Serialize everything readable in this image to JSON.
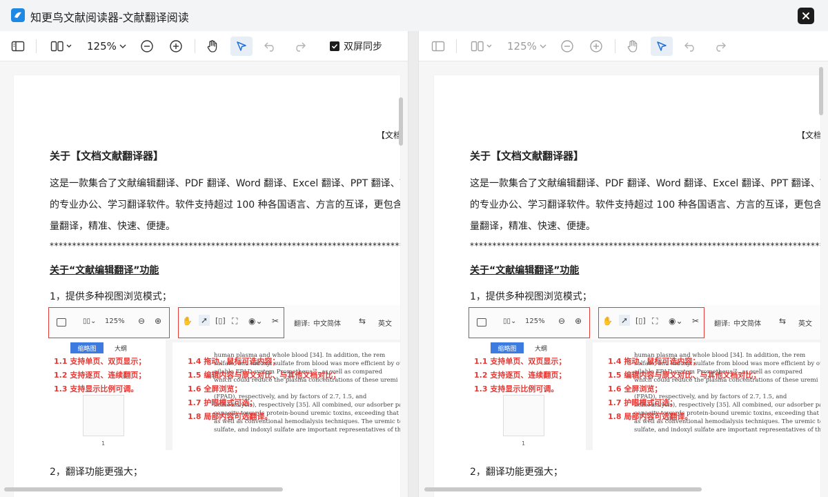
{
  "window": {
    "title": "知更鸟文献阅读器-文献翻译阅读"
  },
  "toolbar": {
    "zoom": "125%",
    "sync_label": "双屏同步",
    "sync_checked": true
  },
  "document": {
    "header_tag": "【文档",
    "title": "关于【文档文献翻译器】",
    "paragraph_lines": [
      "这是一款集合了文献编辑翻译、PDF 翻译、Word 翻译、Excel 翻译、PPT 翻译、TXT 翻",
      "的专业办公、学习翻译软件。软件支持超过 100 种各国语言、方言的互译，更包含了文",
      "量翻译，精准、快速、便捷。"
    ],
    "separator": "**********************************************************************************************************************",
    "section_title": "关于“文献编辑翻译”功能",
    "item1": "1，提供多种视图浏览模式；",
    "item2": "2，翻译功能更强大；",
    "illustration": {
      "zoom": "125%",
      "translate_label": "翻译:",
      "source_lang": "中文简体",
      "target_lang": "英文",
      "tab_thumbnail": "缩略图",
      "tab_outline": "大纲",
      "thumb_page_number": "1",
      "features_left": [
        "1.1  支持单页、双页显示；",
        "1.2  支持逐页、连续翻页；",
        "1.3  支持显示比例可调。"
      ],
      "features_right": [
        "1.4  拖动、鼠标可选内容；",
        "1.5  编辑内容与原文对比、与其他文档对比；",
        "1.6  全屏浏览；",
        "1.7  护眼模式可选；",
        "1.8  局部内容可选翻译。"
      ],
      "article_lines": [
        "human plasma and whole blood [34]. In addition, the rem",
        "sulfate, and indoxyl sulfate from blood was more efficient by our",
        "ailable FPAD system Prometheus™, as well as compared",
        "which could reduce the plasma concentrations of these uremi",
        "(FPAD), respectively, and by factors of 2.7, 1.5, and",
        "hemodialysis), respectively [35]. All combined, our adsorber particle s",
        "capacity towards protein-bound uremic toxins, exceeding that of currently",
        "as well as conventional hemodialysis techniques. The uremic toxins p",
        "sulfate, and indoxyl sulfate are important representatives of the group of h"
      ]
    }
  },
  "colors": {
    "accent": "#1e88e5",
    "highlight_red": "#e53935",
    "thumb_tab": "#3d7be0"
  }
}
